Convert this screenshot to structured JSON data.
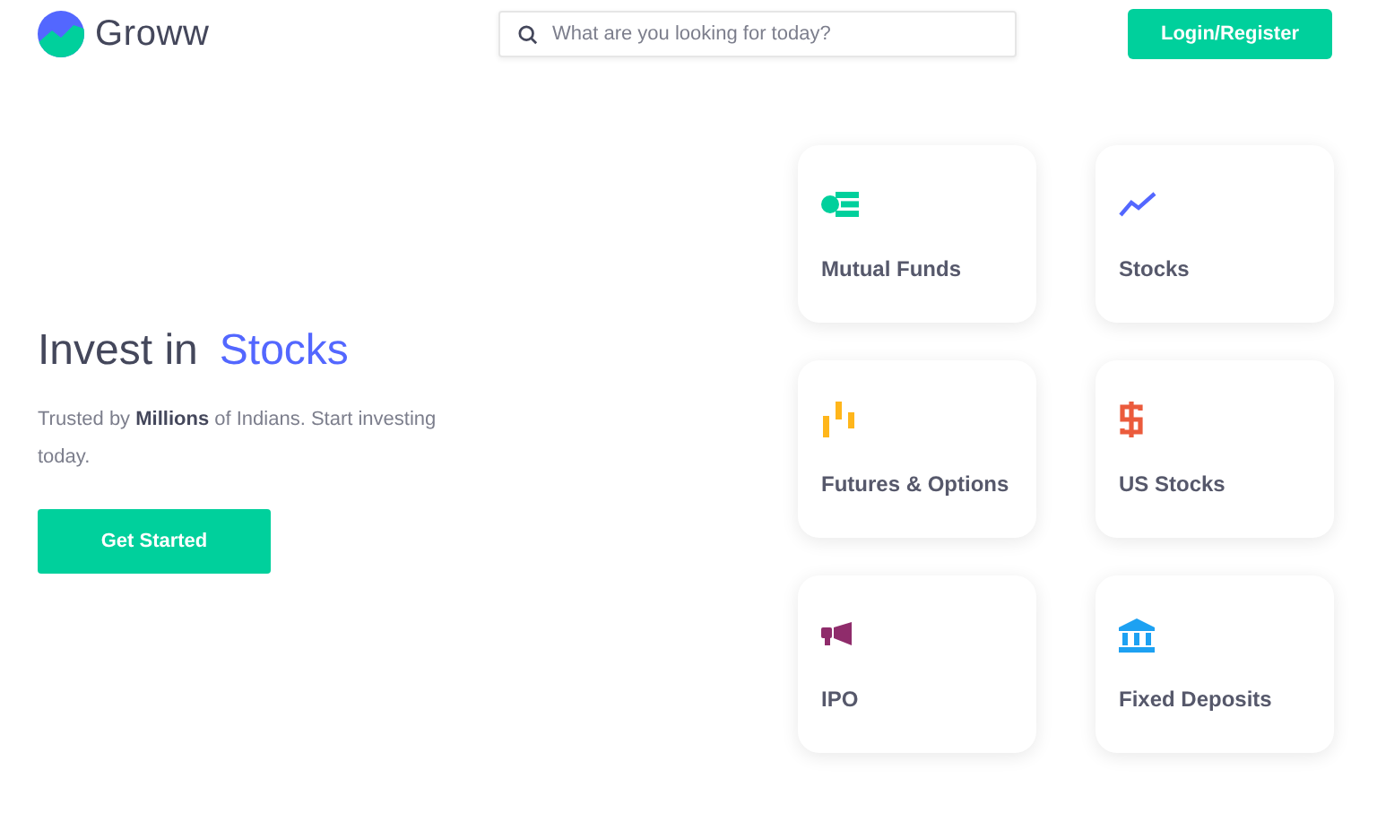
{
  "header": {
    "logo_text": "Groww",
    "search": {
      "placeholder": "What are you looking for today?"
    },
    "login_button": "Login/Register"
  },
  "hero": {
    "title_prefix": "Invest in",
    "title_highlight": "Stocks",
    "subtitle": "Trusted by **Millions** of Indians. Start investing today.",
    "cta_button": "Get Started"
  },
  "products": [
    {
      "label": "Mutual Funds",
      "kind": "funds",
      "color": "#00d09c"
    },
    {
      "label": "Stocks",
      "kind": "stocks",
      "color": "#5367ff"
    },
    {
      "label": "Futures & Options",
      "kind": "candles",
      "color": "#ffb61b"
    },
    {
      "label": "US Stocks",
      "kind": "dollar",
      "color": "#eb5b3c"
    },
    {
      "label": "IPO",
      "kind": "megaphone",
      "color": "#8f2c6b"
    },
    {
      "label": "Fixed Deposits",
      "kind": "bank",
      "color": "#1da1f2"
    }
  ]
}
